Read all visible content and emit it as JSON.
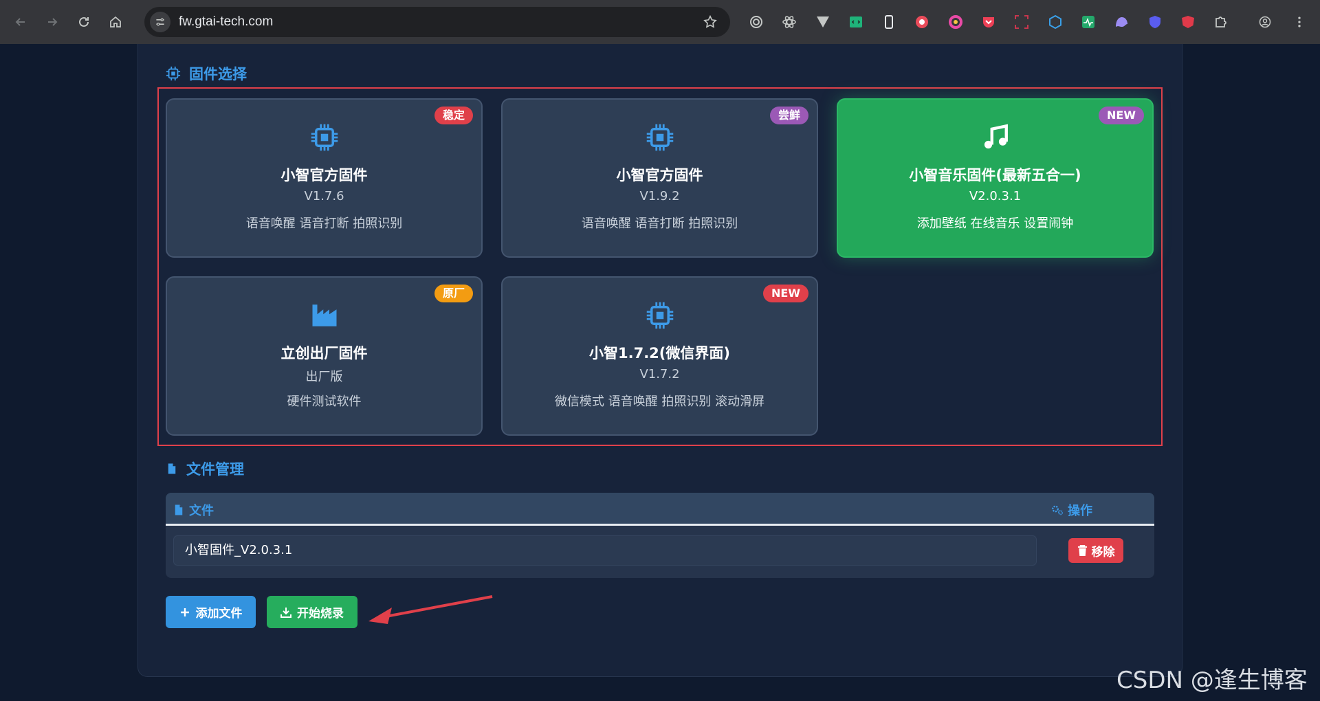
{
  "browser": {
    "url": "fw.gtai-tech.com",
    "extensions": [
      {
        "icon": "target-icon",
        "color": "#c4c7c5"
      },
      {
        "icon": "atom-icon",
        "color": "#c4c7c5"
      },
      {
        "icon": "vue-icon",
        "color": "#c4c7c5"
      },
      {
        "icon": "code-window-icon",
        "color": "#1fb37a"
      },
      {
        "icon": "phone-icon",
        "color": "#e8eaed"
      },
      {
        "icon": "color-wheel-icon",
        "color": "#ea4b5a"
      },
      {
        "icon": "ring-icon",
        "color": "#e84aa6"
      },
      {
        "icon": "pocket-icon",
        "color": "#ee4056"
      },
      {
        "icon": "screenshot-icon",
        "color": "#c7364d"
      },
      {
        "icon": "cube-icon",
        "color": "#3aa0e8"
      },
      {
        "icon": "pulse-icon",
        "color": "#24a86b"
      },
      {
        "icon": "ghost-icon",
        "color": "#9b8cf2"
      },
      {
        "icon": "shield-icon",
        "color": "#5a5df0"
      },
      {
        "icon": "angular-icon",
        "color": "#e03a4a"
      },
      {
        "icon": "puzzle-icon",
        "color": "#c4c7c5"
      }
    ]
  },
  "firmware_section": {
    "title": "固件选择",
    "cards": [
      {
        "title": "小智官方固件",
        "version": "V1.7.6",
        "desc": "语音唤醒 语音打断 拍照识别",
        "badge": "稳定",
        "badge_color": "#e0404a",
        "icon": "chip-icon",
        "selected": false
      },
      {
        "title": "小智官方固件",
        "version": "V1.9.2",
        "desc": "语音唤醒 语音打断 拍照识别",
        "badge": "尝鲜",
        "badge_color": "#9b59b6",
        "icon": "chip-icon",
        "selected": false
      },
      {
        "title": "小智音乐固件(最新五合一)",
        "version": "V2.0.3.1",
        "desc": "添加壁纸 在线音乐 设置闹钟",
        "badge": "NEW",
        "badge_color": "#9b59b6",
        "icon": "music-icon",
        "selected": true
      },
      {
        "title": "立创出厂固件",
        "version": "出厂版",
        "desc": "硬件测试软件",
        "badge": "原厂",
        "badge_color": "#f39c12",
        "icon": "factory-icon",
        "selected": false
      },
      {
        "title": "小智1.7.2(微信界面)",
        "version": "V1.7.2",
        "desc": "微信模式 语音唤醒 拍照识别 滚动滑屏",
        "badge": "NEW",
        "badge_color": "#e0404a",
        "icon": "chip-icon",
        "selected": false
      }
    ]
  },
  "file_section": {
    "title": "文件管理",
    "col_file": "文件",
    "col_action": "操作",
    "rows": [
      {
        "name": "小智固件_V2.0.3.1",
        "action": "移除"
      }
    ]
  },
  "actions": {
    "add_file": "添加文件",
    "start_burn": "开始烧录"
  },
  "watermark": "CSDN @逢生博客"
}
